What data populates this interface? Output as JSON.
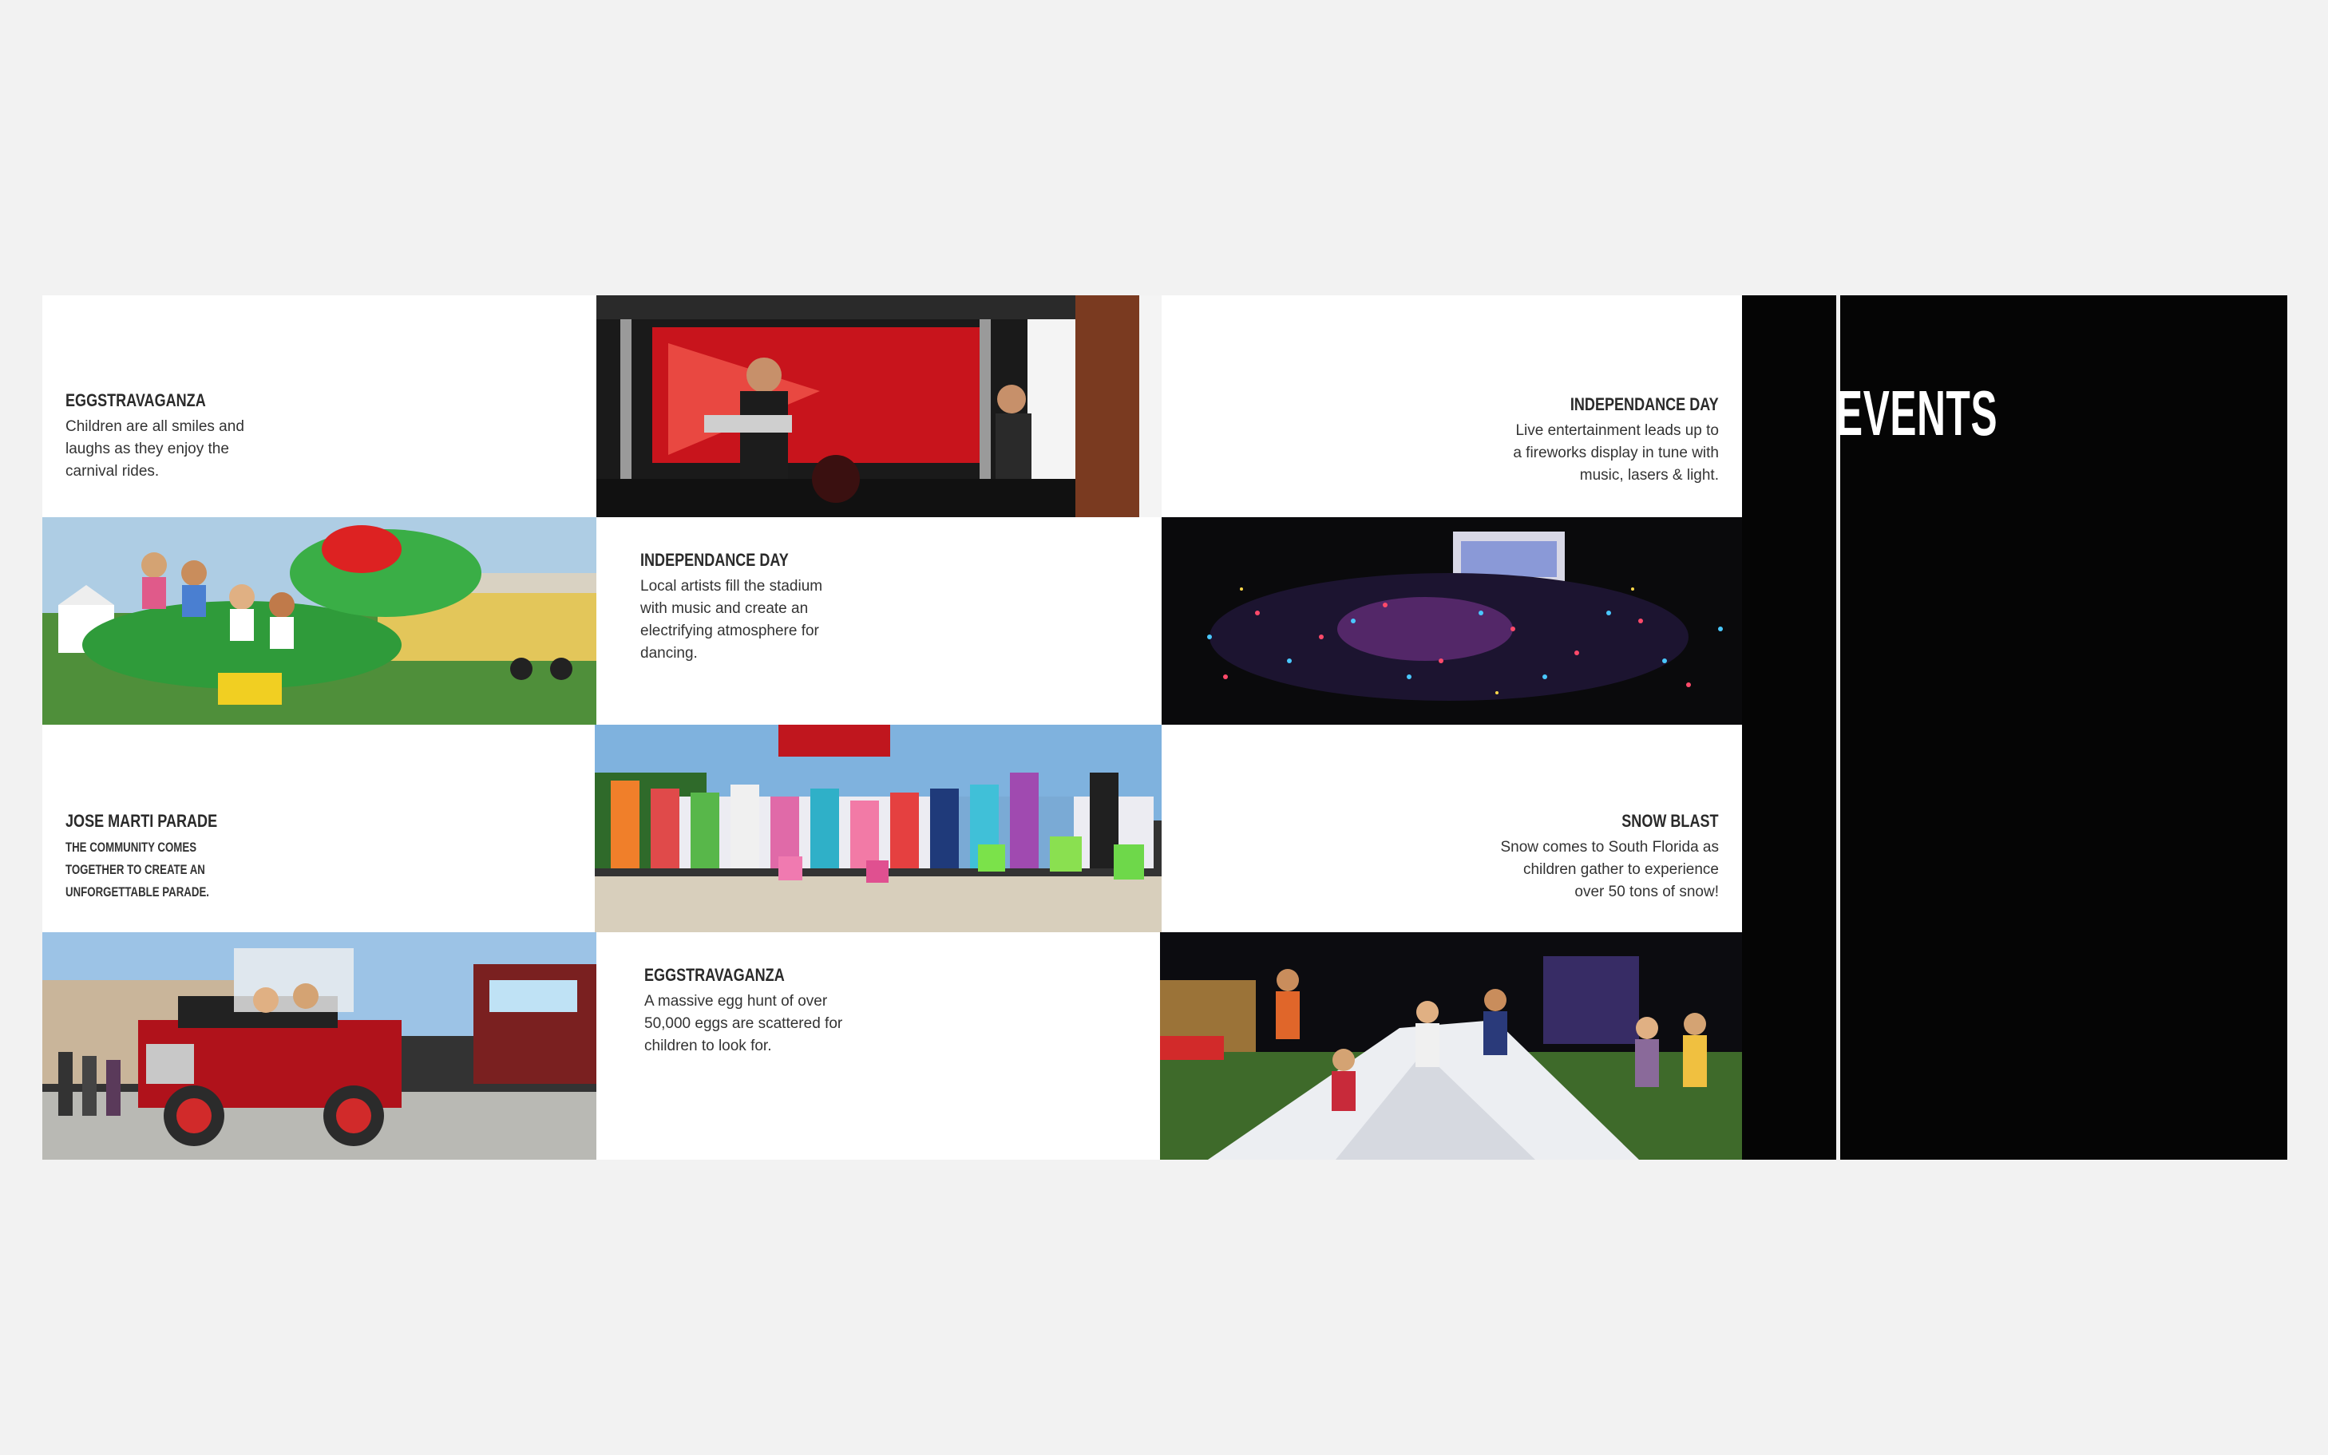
{
  "section_title": "EVENTS",
  "captions": {
    "eggstravaganza_rides": {
      "title": "EGGSTRAVAGANZA",
      "body": "Children are all smiles and\nlaughs as they enjoy the\ncarnival rides."
    },
    "independance_stadium": {
      "title": "INDEPENDANCE DAY",
      "body": "Local artists fill the stadium\nwith music and create an\nelectrifying atmosphere for\ndancing."
    },
    "independance_fireworks": {
      "title": "INDEPENDANCE DAY",
      "body": "Live entertainment leads up to\na fireworks display in tune with\nmusic, lasers & light."
    },
    "jose_marti": {
      "title": "JOSE MARTI PARADE",
      "body": "THE COMMUNITY COMES\n TOGETHER TO CREATE AN\nUNFORGETTABLE PARADE."
    },
    "snow_blast": {
      "title": "SNOW BLAST",
      "body": "Snow comes to South Florida as\nchildren gather to experience\nover 50 tons of snow!"
    },
    "eggstravaganza_hunt": {
      "title": "EGGSTRAVAGANZA",
      "body": "A massive egg hunt of over\n50,000 eggs are scattered for\nchildren to look for."
    }
  },
  "photos": {
    "concert_stage": "concert stage with guitarist and red LED screen",
    "gator_ride": "children riding a green alligator carnival ride",
    "night_crowd": "nighttime crowd with glowsticks in front of a lit stage",
    "egg_hunt_kids": "children holding colorful buckets at egg hunt",
    "fire_truck": "vintage red fire truck in parade",
    "snow_hill": "children climbing a snow pile at night"
  }
}
